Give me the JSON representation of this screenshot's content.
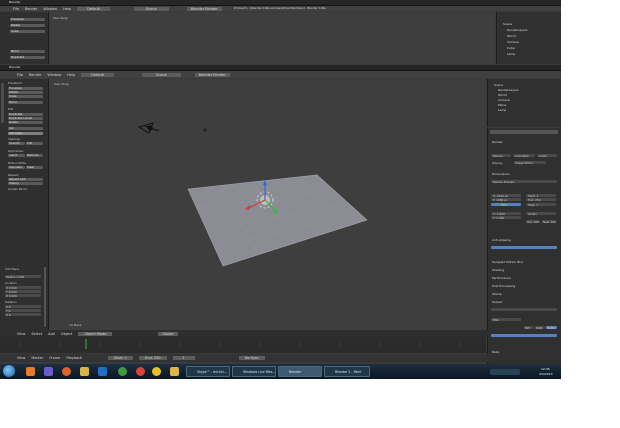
{
  "top_window": {
    "title": "Blender",
    "viewport_label": "User Persp",
    "info_text": "D:\\\\Users\\\\...\\\\blender-2.66a-windows64\\\\untitled.blend  -  Blender 2.66a",
    "menu": [
      "File",
      "Render",
      "Window",
      "Help"
    ],
    "layout_select": "Default",
    "scene_select": "Scene",
    "engine_select": "Blender Render",
    "left_items": [
      "Translate",
      "Rotate",
      "Scale",
      "Mirror",
      "Duplicate"
    ],
    "outliner_items": [
      "Scene",
      "RenderLayers",
      "World",
      "Camera",
      "Cube",
      "Lamp"
    ]
  },
  "main_window": {
    "title": "Blender",
    "menu": [
      "File",
      "Render",
      "Window",
      "Help"
    ],
    "layout_select": "Default",
    "scene_select": "Scene",
    "engine_select": "Blender Render",
    "viewport_label": "User Persp",
    "viewport_footer": "(1) Plane",
    "tool_shelf": {
      "section_transform": "Transform:",
      "buttons": [
        "Translate",
        "Rotate",
        "Scale",
        "Mirror",
        "Edit",
        "Duplicate",
        "Duplicate Linked",
        "Delete",
        "Join",
        "Set Origin",
        "Shading:",
        "Smooth",
        "Flat",
        "Keyframes:",
        "Insert",
        "Remove",
        "Motion Paths",
        "Calculate",
        "Clear",
        "Repeat:",
        "Repeat Last",
        "History",
        "Grease Pencil:"
      ],
      "section_add_plane": "Add Plane",
      "fields": [
        "Radius 1.000",
        "Location",
        "X 0.000",
        "Y 0.000",
        "Z 0.000",
        "Rotation",
        "X 0",
        "Y 0",
        "Z 0"
      ]
    },
    "viewport_header": {
      "items": [
        "View",
        "Select",
        "Add",
        "Object",
        "Object Mode",
        "Global"
      ]
    },
    "outliner_items": [
      "Scene",
      "RenderLayers",
      "World",
      "Camera",
      "Plane",
      "Lamp"
    ],
    "properties": {
      "render_header": "Render",
      "render_buttons": [
        "Render",
        "Animation",
        "Audio"
      ],
      "display_label": "Display:",
      "display_value": "Image Editor",
      "dimensions_header": "Dimensions",
      "preset": "Render Presets",
      "resolution": [
        "X: 1920 px",
        "Y: 1080 px",
        "50%"
      ],
      "frame_range": [
        "Start: 1",
        "End: 250",
        "Step: 1"
      ],
      "aspect": [
        "X: 1.000",
        "Y: 1.000"
      ],
      "frame_rate": "24 fps",
      "time_remap": [
        "Old: 100",
        "New: 100"
      ],
      "sections": [
        "Anti-Aliasing",
        "Sampled Motion Blur",
        "Shading",
        "Performance",
        "Post Processing",
        "Stamp",
        "Output",
        "Bake"
      ],
      "output_format": "PNG",
      "color_modes": [
        "BW",
        "RGB",
        "RGBA"
      ]
    },
    "timeline": {
      "items": [
        "View",
        "Marker",
        "Frame",
        "Playback",
        "Start: 1",
        "End: 250",
        "1",
        "No Sync"
      ]
    }
  },
  "taskbar": {
    "tasks": [
      "Skype™ - michal...",
      "Windows Live Mes...",
      "Blender",
      "Blender 2 - Paint"
    ],
    "clock_time": "12:45",
    "clock_date": "3/3/2013"
  },
  "colors": {
    "accent_blue": "#5680c2",
    "x_axis": "#d23a3a",
    "y_axis": "#3ab54a",
    "z_axis": "#2a6cd6"
  }
}
